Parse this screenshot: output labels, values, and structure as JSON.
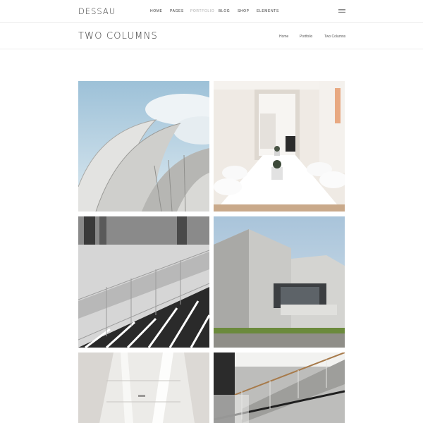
{
  "header": {
    "logo": "DESSAU",
    "nav": [
      {
        "label": "HOME",
        "active": false
      },
      {
        "label": "PAGES",
        "active": false
      },
      {
        "label": "PORTFOLIO",
        "active": true
      },
      {
        "label": "BLOG",
        "active": false
      },
      {
        "label": "SHOP",
        "active": false
      },
      {
        "label": "ELEMENTS",
        "active": false
      }
    ],
    "menu_icon": "hamburger-icon"
  },
  "title_bar": {
    "title": "TWO COLUMNS",
    "breadcrumb": [
      "Home",
      "Portfolio",
      "Two Columns"
    ]
  },
  "portfolio": {
    "items": [
      {
        "image": "opera-house-shells"
      },
      {
        "image": "white-meeting-room"
      },
      {
        "image": "concrete-staircase"
      },
      {
        "image": "concrete-building-sky"
      },
      {
        "image": "white-ceiling-beams"
      },
      {
        "image": "stairs-railing-wood"
      }
    ]
  },
  "colors": {
    "text": "#333333",
    "nav_active": "#a8a8a8",
    "divider": "#ececec"
  }
}
